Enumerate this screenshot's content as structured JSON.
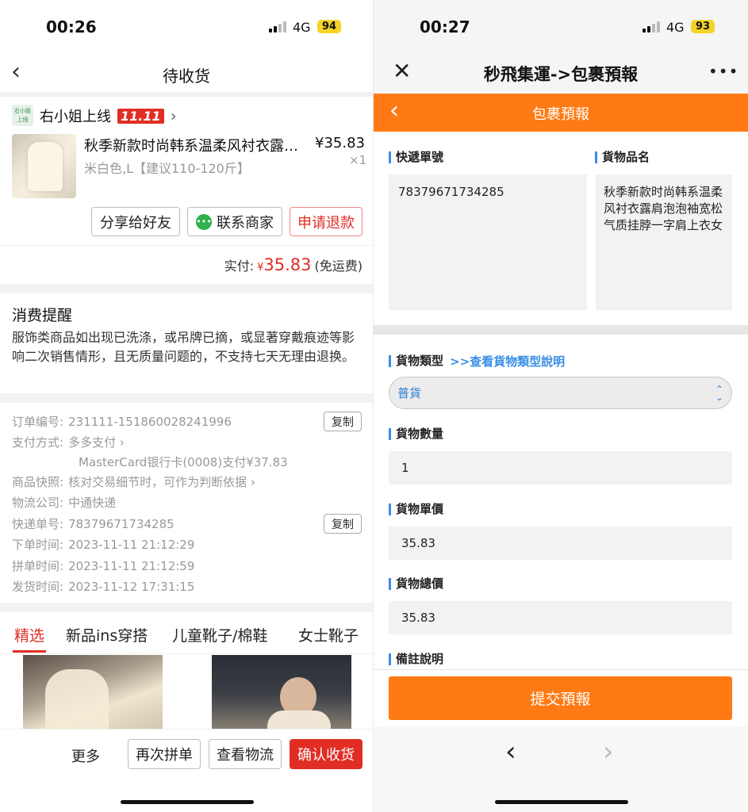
{
  "left": {
    "status": {
      "time": "00:26",
      "network": "4G",
      "battery": "94"
    },
    "header": {
      "title": "待收货"
    },
    "shop": {
      "logo_text": "右小姐上线",
      "name": "右小姐上线",
      "badge": "11.11"
    },
    "product": {
      "title": "秋季新款时尚韩系温柔风衬衣露…",
      "price": "¥35.83",
      "spec": "米白色,L【建议110-120斤】",
      "qty": "×1"
    },
    "actions": {
      "share": "分享给好友",
      "contact": "联系商家",
      "refund": "申请退款"
    },
    "payment": {
      "label": "实付:",
      "currency": "¥",
      "amount": "35.83",
      "note": "(免运费)"
    },
    "reminder": {
      "title": "消费提醒",
      "text": "服饰类商品如出现已洗涤，或吊牌已摘，或显著穿戴痕迹等影响二次销售情形，且无质量问题的，不支持七天无理由退换。"
    },
    "order_info": {
      "copy_label": "复制",
      "order_no_label": "订单编号:",
      "order_no": "231111-151860028241996",
      "pay_method_label": "支付方式:",
      "pay_method": "多多支付 ›",
      "pay_detail": "MasterCard银行卡(0008)支付¥37.83",
      "snapshot_label": "商品快照:",
      "snapshot": "核对交易细节时，可作为判断依据 ›",
      "logistics_label": "物流公司:",
      "logistics": "中通快递",
      "tracking_label": "快递单号:",
      "tracking": "78379671734285",
      "order_time_label": "下单时间:",
      "order_time": "2023-11-11 21:12:29",
      "group_time_label": "拼单时间:",
      "group_time": "2023-11-11 21:12:59",
      "ship_time_label": "发货时间:",
      "ship_time": "2023-11-12 17:31:15"
    },
    "tabs": [
      "精选",
      "新品ins穿搭",
      "儿童靴子/棉鞋",
      "女士靴子"
    ],
    "bottom": {
      "more": "更多",
      "regroup": "再次拼单",
      "logistics": "查看物流",
      "confirm": "确认收货"
    }
  },
  "right": {
    "status": {
      "time": "00:27",
      "network": "4G",
      "battery": "93"
    },
    "header": {
      "title": "秒飛集運->包裹預報"
    },
    "subheader": {
      "title": "包裹預報"
    },
    "fields": {
      "tracking_label": "快遞單號",
      "tracking_value": "78379671734285",
      "name_label": "貨物品名",
      "name_value": "秋季新款时尚韩系温柔风衬衣露肩泡泡袖宽松气质挂脖一字肩上衣女",
      "type_label": "貨物類型",
      "type_link": ">>查看貨物類型說明",
      "type_value": "普貨",
      "qty_label": "貨物數量",
      "qty_value": "1",
      "unit_price_label": "貨物單價",
      "unit_price_value": "35.83",
      "total_label": "貨物總價",
      "total_value": "35.83",
      "remark_label": "備註說明"
    },
    "submit": "提交預報"
  },
  "colors": {
    "accent_red": "#e02e24",
    "accent_orange": "#ff7a14",
    "link_blue": "#3a8ee6"
  }
}
